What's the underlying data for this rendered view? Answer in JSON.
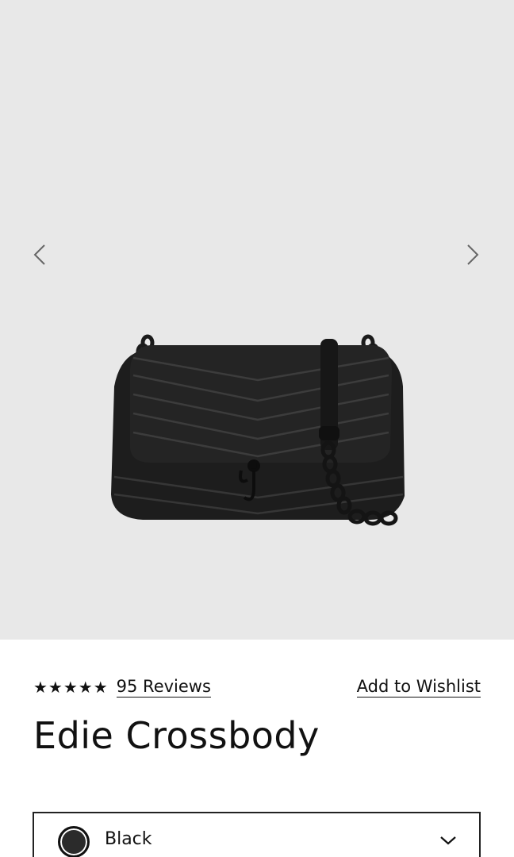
{
  "gallery": {
    "background": "#e8e8e8",
    "prev_icon": "chevron-left-icon",
    "next_icon": "chevron-right-icon",
    "image_subject": "black quilted chevron crossbody bag with black chain strap"
  },
  "product": {
    "rating_stars": "★★★★★",
    "rating_value": 5,
    "reviews_label": "95 Reviews",
    "wishlist_label": "Add to Wishlist",
    "title": "Edie Crossbody"
  },
  "color_selector": {
    "selected_label": "Black",
    "swatch_color": "#2b2b2b",
    "dropdown_icon": "chevron-down-icon"
  }
}
